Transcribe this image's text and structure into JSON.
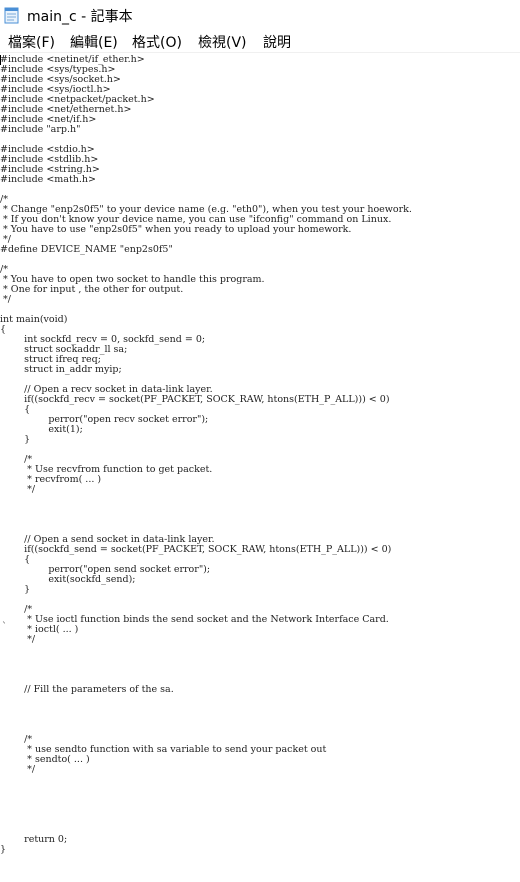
{
  "window": {
    "title": "main_c - 記事本"
  },
  "menu": {
    "file": "檔案(F)",
    "edit": "編輯(E)",
    "format": "格式(O)",
    "view": "檢視(V)",
    "help": "說明"
  },
  "editor": {
    "lines": [
      "#include <netinet/if_ether.h>",
      "#include <sys/types.h>",
      "#include <sys/socket.h>",
      "#include <sys/ioctl.h>",
      "#include <netpacket/packet.h>",
      "#include <net/ethernet.h>",
      "#include <net/if.h>",
      "#include \"arp.h\"",
      "",
      "#include <stdio.h>",
      "#include <stdlib.h>",
      "#include <string.h>",
      "#include <math.h>",
      "",
      "/*",
      " * Change \"enp2s0f5\" to your device name (e.g. \"eth0\"), when you test your hoework.",
      " * If you don't know your device name, you can use \"ifconfig\" command on Linux.",
      " * You have to use \"enp2s0f5\" when you ready to upload your homework.",
      " */",
      "#define DEVICE_NAME \"enp2s0f5\"",
      "",
      "/*",
      " * You have to open two socket to handle this program.",
      " * One for input , the other for output.",
      " */",
      "",
      "int main(void)",
      "{",
      "        int sockfd_recv = 0, sockfd_send = 0;",
      "        struct sockaddr_ll sa;",
      "        struct ifreq req;",
      "        struct in_addr myip;",
      "",
      "        // Open a recv socket in data-link layer.",
      "        if((sockfd_recv = socket(PF_PACKET, SOCK_RAW, htons(ETH_P_ALL))) < 0)",
      "        {",
      "                perror(\"open recv socket error\");",
      "                exit(1);",
      "        }",
      "",
      "        /*",
      "         * Use recvfrom function to get packet.",
      "         * recvfrom( ... )",
      "         */",
      "",
      "",
      "",
      "",
      "        // Open a send socket in data-link layer.",
      "        if((sockfd_send = socket(PF_PACKET, SOCK_RAW, htons(ETH_P_ALL))) < 0)",
      "        {",
      "                perror(\"open send socket error\");",
      "                exit(sockfd_send);",
      "        }",
      "",
      "        /*",
      "         * Use ioctl function binds the send socket and the Network Interface Card.",
      "         * ioctl( ... )",
      "         */",
      "",
      "",
      "",
      "",
      "        // Fill the parameters of the sa.",
      "",
      "",
      "",
      "",
      "        /*",
      "         * use sendto function with sa variable to send your packet out",
      "         * sendto( ... )",
      "         */",
      "",
      "",
      "",
      "",
      "",
      "",
      "        return 0;",
      "}"
    ],
    "stray_mark": "`"
  },
  "colors": {
    "text": "#222222",
    "background": "#ffffff",
    "icon_blue": "#4a8fd6"
  }
}
